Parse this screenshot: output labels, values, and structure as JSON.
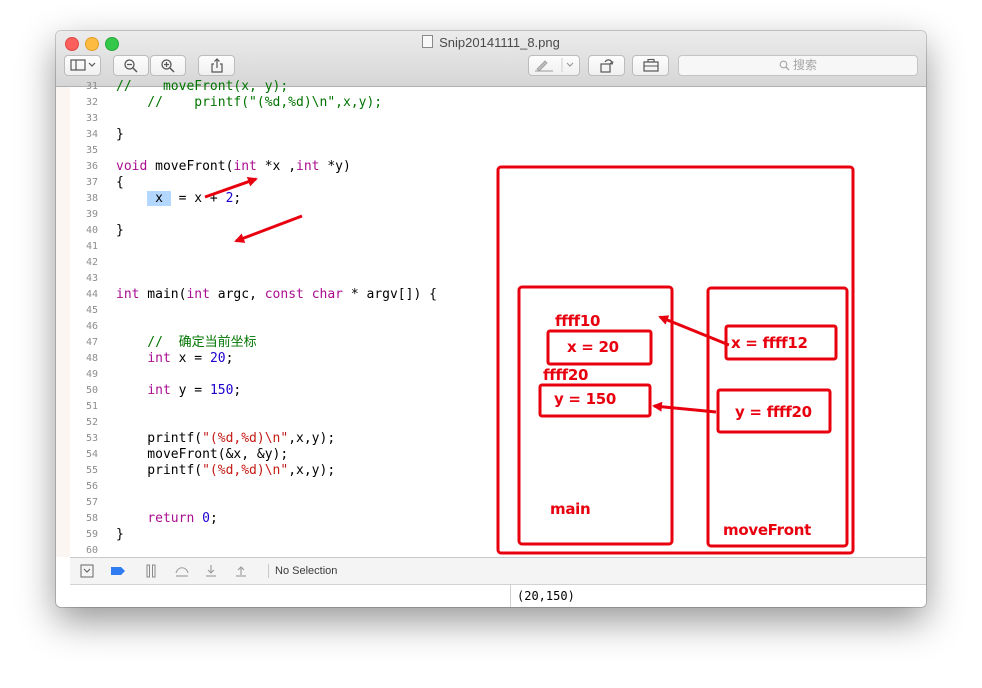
{
  "window": {
    "title": "Snip20141111_8.png",
    "search_placeholder": "搜索"
  },
  "editor": {
    "lines": [
      {
        "n": "31",
        "segments": [
          {
            "t": "//    ",
            "c": "cm"
          },
          {
            "t": "moveFront(x, y);",
            "c": "cm"
          }
        ]
      },
      {
        "n": "32",
        "segments": [
          {
            "t": "    //    printf(\"(%d,%d)\\n\",x,y);",
            "c": "cm"
          }
        ]
      },
      {
        "n": "33",
        "segments": []
      },
      {
        "n": "34",
        "segments": [
          {
            "t": "}",
            "c": ""
          }
        ]
      },
      {
        "n": "35",
        "segments": []
      },
      {
        "n": "36",
        "segments": [
          {
            "t": "void",
            "c": "kw"
          },
          {
            "t": " moveFront(",
            "c": ""
          },
          {
            "t": "int",
            "c": "kw"
          },
          {
            "t": " *x ,",
            "c": ""
          },
          {
            "t": "int",
            "c": "kw"
          },
          {
            "t": " *y)",
            "c": ""
          }
        ]
      },
      {
        "n": "37",
        "segments": [
          {
            "t": "{",
            "c": ""
          }
        ]
      },
      {
        "n": "38",
        "segments": [
          {
            "t": "    ",
            "c": ""
          },
          {
            "t": " x ",
            "c": "sel"
          },
          {
            "t": " = x + ",
            "c": ""
          },
          {
            "t": "2",
            "c": "nm"
          },
          {
            "t": ";",
            "c": ""
          }
        ]
      },
      {
        "n": "39",
        "segments": []
      },
      {
        "n": "40",
        "segments": [
          {
            "t": "}",
            "c": ""
          }
        ]
      },
      {
        "n": "41",
        "segments": []
      },
      {
        "n": "42",
        "segments": []
      },
      {
        "n": "43",
        "segments": []
      },
      {
        "n": "44",
        "segments": [
          {
            "t": "int",
            "c": "kw"
          },
          {
            "t": " main(",
            "c": ""
          },
          {
            "t": "int",
            "c": "kw"
          },
          {
            "t": " argc, ",
            "c": ""
          },
          {
            "t": "const",
            "c": "kw"
          },
          {
            "t": " ",
            "c": ""
          },
          {
            "t": "char",
            "c": "kw"
          },
          {
            "t": " * argv[]) {",
            "c": ""
          }
        ]
      },
      {
        "n": "45",
        "segments": []
      },
      {
        "n": "46",
        "segments": []
      },
      {
        "n": "47",
        "segments": [
          {
            "t": "    //  确定当前坐标",
            "c": "cm"
          }
        ]
      },
      {
        "n": "48",
        "segments": [
          {
            "t": "    ",
            "c": ""
          },
          {
            "t": "int",
            "c": "kw"
          },
          {
            "t": " x = ",
            "c": ""
          },
          {
            "t": "20",
            "c": "nm"
          },
          {
            "t": ";",
            "c": ""
          }
        ]
      },
      {
        "n": "49",
        "segments": []
      },
      {
        "n": "50",
        "segments": [
          {
            "t": "    ",
            "c": ""
          },
          {
            "t": "int",
            "c": "kw"
          },
          {
            "t": " y = ",
            "c": ""
          },
          {
            "t": "150",
            "c": "nm"
          },
          {
            "t": ";",
            "c": ""
          }
        ]
      },
      {
        "n": "51",
        "segments": []
      },
      {
        "n": "52",
        "segments": []
      },
      {
        "n": "53",
        "segments": [
          {
            "t": "    printf(",
            "c": ""
          },
          {
            "t": "\"(%d,%d)\\n\"",
            "c": "st"
          },
          {
            "t": ",x,y);",
            "c": ""
          }
        ]
      },
      {
        "n": "54",
        "segments": [
          {
            "t": "    moveFront(&x, &y);",
            "c": ""
          }
        ]
      },
      {
        "n": "55",
        "segments": [
          {
            "t": "    printf(",
            "c": ""
          },
          {
            "t": "\"(%d,%d)\\n\"",
            "c": "st"
          },
          {
            "t": ",x,y);",
            "c": ""
          }
        ]
      },
      {
        "n": "56",
        "segments": []
      },
      {
        "n": "57",
        "segments": []
      },
      {
        "n": "58",
        "segments": [
          {
            "t": "    ",
            "c": ""
          },
          {
            "t": "return",
            "c": "kw"
          },
          {
            "t": " ",
            "c": ""
          },
          {
            "t": "0",
            "c": "nm"
          },
          {
            "t": ";",
            "c": ""
          }
        ]
      },
      {
        "n": "59",
        "segments": [
          {
            "t": "}",
            "c": ""
          }
        ]
      },
      {
        "n": "60",
        "segments": []
      }
    ]
  },
  "debug_bar": {
    "selection_text": "No Selection"
  },
  "console": {
    "output": "(20,150)"
  },
  "annotations": {
    "accent_color": "#e8000e",
    "main_addr_x": "ffff10",
    "main_x_value": "x  =  20",
    "main_addr_y": "ffff20",
    "main_y_value": "y = 150",
    "main_label": "main",
    "mf_x_value": "x = ffff12",
    "mf_y_value": "y = ffff20",
    "mf_label": "moveFront"
  }
}
